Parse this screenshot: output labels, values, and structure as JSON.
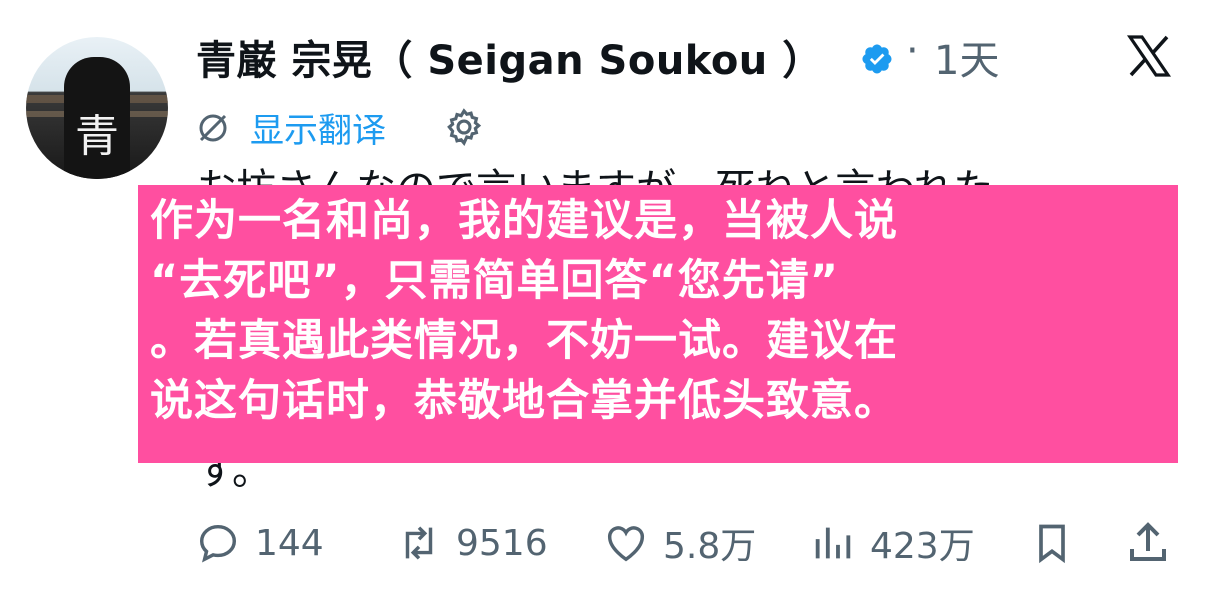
{
  "author": {
    "name": "青巌 宗晃（ Seigan Soukou ）",
    "avatar_char": "青"
  },
  "post": {
    "separator": "·",
    "time": "1天",
    "translate_label": "显示翻译",
    "original_line_1": "お坊さんなので言いますが、死ねと言われた",
    "original_last": "す。",
    "overlay_lines": [
      "作为一名和尚，我的建议是，当被人说",
      "“去死吧”，只需简单回答“您先请”",
      "。若真遇此类情况，不妨一试。建议在",
      "说这句话时，恭敬地合掌并低头致意。"
    ]
  },
  "actions": {
    "replies": "144",
    "reposts": "9516",
    "likes": "5.8万",
    "views": "423万"
  },
  "colors": {
    "accent": "#1d9bf0",
    "overlay": "#ff4fa0",
    "muted": "#536471"
  }
}
